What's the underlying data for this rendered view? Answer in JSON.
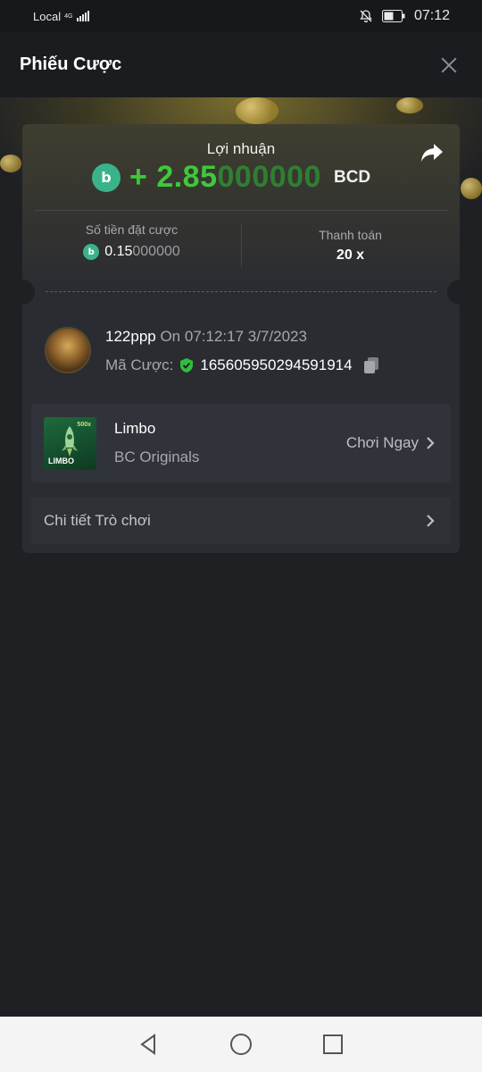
{
  "status_bar": {
    "carrier": "Local",
    "network": "4G",
    "time": "07:12"
  },
  "header": {
    "title": "Phiếu Cược"
  },
  "profit": {
    "label": "Lợi nhuận",
    "prefix": "+ ",
    "value_main": "2.85",
    "value_dim": "000000",
    "currency": "BCD"
  },
  "stats": {
    "bet_amount_label": "Số tiền đặt cược",
    "bet_amount_main": "0.15",
    "bet_amount_dim": "000000",
    "payout_label": "Thanh toán",
    "payout_value": "20 x"
  },
  "bet": {
    "username": "122ppp",
    "timestamp": " On 07:12:17 3/7/2023",
    "id_label": "Mã Cược:",
    "id_value": "165605950294591914"
  },
  "game": {
    "name": "Limbo",
    "provider": "BC Originals",
    "thumb_text": "LIMBO",
    "thumb_multiplier": "500x",
    "play_label": "Chơi Ngay"
  },
  "details": {
    "label": "Chi tiết Trò chơi"
  },
  "colors": {
    "profit_green": "#3fc83b",
    "coin_teal": "#3bb38a",
    "background": "#1f2024"
  }
}
